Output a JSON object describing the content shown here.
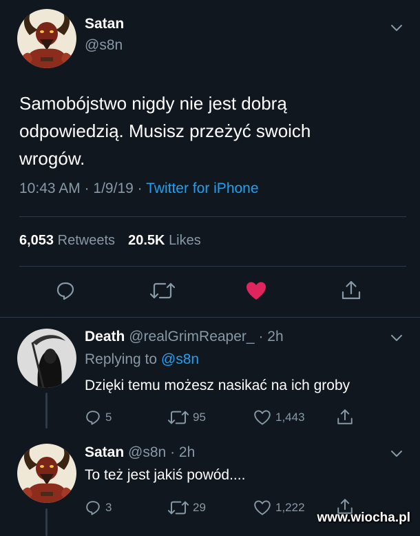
{
  "main_tweet": {
    "author_name": "Satan",
    "author_handle": "@s8n",
    "text": "Samobójstwo nigdy nie jest dobrą odpowiedzią. Musisz przeżyć swoich wrogów.",
    "time": "10:43 AM",
    "date": "1/9/19",
    "source": "Twitter for iPhone",
    "separator": "·",
    "retweets_count": "6,053",
    "retweets_label": "Retweets",
    "likes_count": "20.5K",
    "likes_label": "Likes",
    "actions": [
      "reply-icon",
      "retweet-icon",
      "heart-icon",
      "share-icon"
    ],
    "liked_color": "#e0245e"
  },
  "replies": [
    {
      "author_name": "Death",
      "author_handle": "@realGrimReaper_",
      "age": "· 2h",
      "replying_to_label": "Replying to",
      "replying_to_handle": "@s8n",
      "text": "Dzięki temu możesz nasikać na ich groby",
      "reply_count": "5",
      "retweet_count": "95",
      "like_count": "1,443"
    },
    {
      "author_name": "Satan",
      "author_handle": "@s8n",
      "age": "· 2h",
      "text": "To też jest jakiś powód....",
      "reply_count": "3",
      "retweet_count": "29",
      "like_count": "1,222"
    }
  ],
  "watermark": "www.wiocha.pl",
  "colors": {
    "background": "#10171e",
    "text": "#ffffff",
    "muted": "#8899a6",
    "link": "#1da1f2",
    "divider": "#2f3b47"
  }
}
